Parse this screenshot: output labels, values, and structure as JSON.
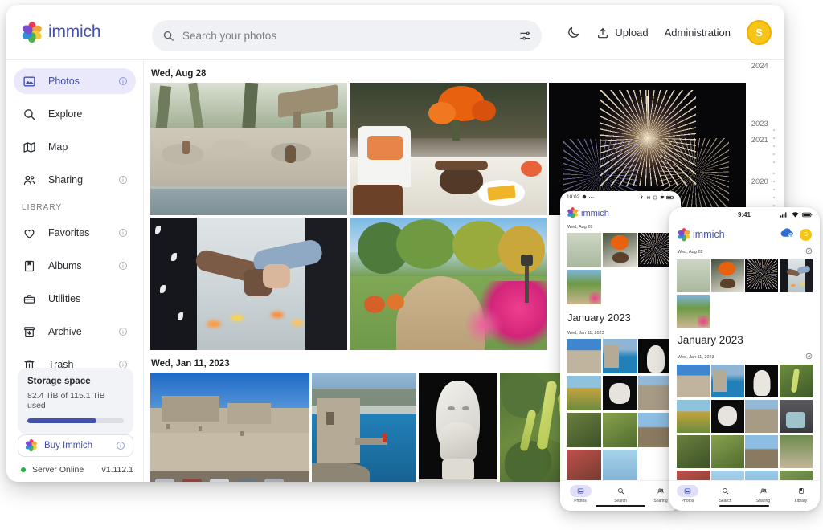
{
  "app": {
    "name": "immich",
    "brand_color": "#4250af"
  },
  "header": {
    "search": {
      "placeholder": "Search your photos",
      "value": "",
      "icon": "search-icon",
      "filter_icon": "filter-sliders-icon"
    },
    "theme_toggle": {
      "label": "",
      "icon": "moon-icon"
    },
    "upload": {
      "label": "Upload",
      "icon": "upload-icon"
    },
    "administration": {
      "label": "Administration"
    },
    "avatar": {
      "initial": "S",
      "color": "#f5c518"
    }
  },
  "sidebar": {
    "primary": [
      {
        "label": "Photos",
        "icon": "photos-icon",
        "active": true,
        "has_info": true
      },
      {
        "label": "Explore",
        "icon": "explore-search-icon",
        "active": false,
        "has_info": false
      },
      {
        "label": "Map",
        "icon": "map-icon",
        "active": false,
        "has_info": false
      },
      {
        "label": "Sharing",
        "icon": "sharing-people-icon",
        "active": false,
        "has_info": true
      }
    ],
    "section_label": "LIBRARY",
    "library": [
      {
        "label": "Favorites",
        "icon": "heart-icon",
        "has_info": true
      },
      {
        "label": "Albums",
        "icon": "albums-icon",
        "has_info": true
      },
      {
        "label": "Utilities",
        "icon": "utilities-toolbox-icon",
        "has_info": false
      },
      {
        "label": "Archive",
        "icon": "archive-box-icon",
        "has_info": true
      },
      {
        "label": "Trash",
        "icon": "trash-icon",
        "has_info": true
      }
    ],
    "storage": {
      "title": "Storage space",
      "usage_text": "82.4 TiB of 115.1 TiB used",
      "percent": 72,
      "fill_color": "#4250af"
    },
    "buy": {
      "label": "Buy Immich",
      "has_info": true
    },
    "server": {
      "status": "Server Online",
      "version": "v1.112.1",
      "dot_color": "#21b14b"
    }
  },
  "timeline": {
    "years": [
      "2024",
      "2023",
      "2021",
      "2020"
    ]
  },
  "main": {
    "groups": [
      {
        "date": "Wed, Aug 28"
      },
      {
        "date": "Wed, Jan 11, 2023"
      }
    ]
  },
  "tablet": {
    "status": {
      "time": "10:02",
      "icons": "bluetooth, dnd, screenshot, wifi, battery"
    },
    "brand": "immich",
    "date_1": "Wed, Aug 28",
    "section": "January 2023",
    "date_2": "Wed, Jan 11, 2023",
    "nav": [
      {
        "label": "Photos",
        "icon": "photos-icon",
        "active": true
      },
      {
        "label": "Search",
        "icon": "search-icon",
        "active": false
      },
      {
        "label": "Sharing",
        "icon": "sharing-people-icon",
        "active": false
      }
    ]
  },
  "phone": {
    "status": {
      "time": "9:41",
      "icons": "cellular, wifi, battery"
    },
    "brand": "immich",
    "cloud_icon": "cloud-upload-icon",
    "avatar_initial": "S",
    "date_1": "Wed, Aug 28",
    "section": "January 2023",
    "date_2": "Wed, Jan 11, 2023",
    "nav": [
      {
        "label": "Photos",
        "icon": "photos-icon",
        "active": true
      },
      {
        "label": "Search",
        "icon": "search-icon",
        "active": false
      },
      {
        "label": "Sharing",
        "icon": "sharing-people-icon",
        "active": false
      },
      {
        "label": "Library",
        "icon": "library-icon",
        "active": false
      }
    ]
  }
}
